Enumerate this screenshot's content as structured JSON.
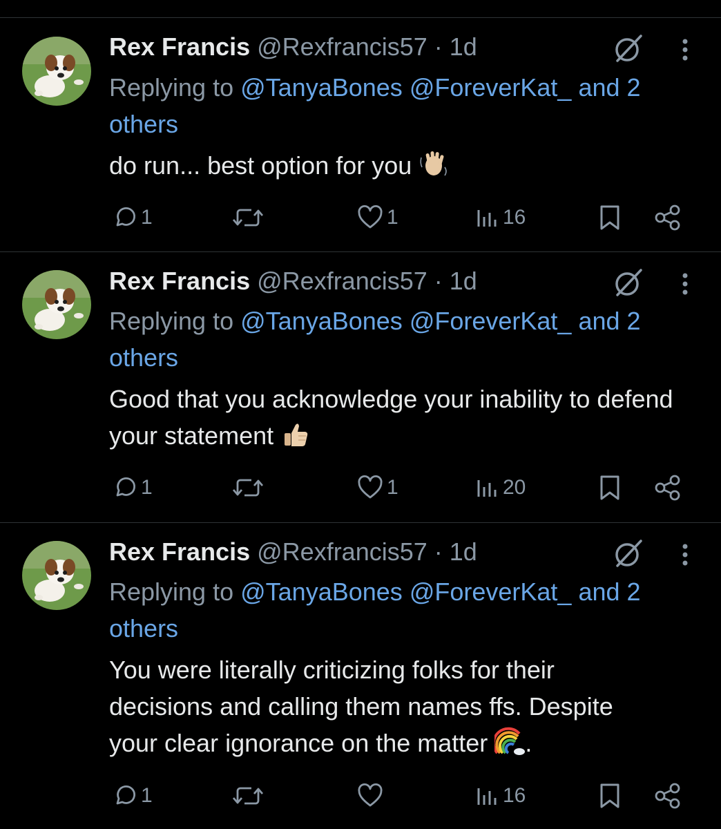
{
  "tweets": [
    {
      "name": "Rex Francis",
      "handle": "@Rexfrancis57",
      "dot": " · ",
      "time": "1d",
      "replying_prefix": "Replying to ",
      "mention1": "@TanyaBones",
      "mention2": "@ForeverKat_",
      "and_others": "and 2 others",
      "text": "do run... best option for you",
      "emoji": "waving-hand",
      "replies": "1",
      "retweets": "",
      "likes": "1",
      "views": "16"
    },
    {
      "name": "Rex Francis",
      "handle": "@Rexfrancis57",
      "dot": " · ",
      "time": "1d",
      "replying_prefix": "Replying to ",
      "mention1": "@TanyaBones",
      "mention2": "@ForeverKat_",
      "and_others": "and 2 others",
      "text": "Good that you acknowledge your inability to defend your statement",
      "emoji": "thumbs-up",
      "replies": "1",
      "retweets": "",
      "likes": "1",
      "views": "20"
    },
    {
      "name": "Rex Francis",
      "handle": "@Rexfrancis57",
      "dot": " · ",
      "time": "1d",
      "replying_prefix": "Replying to ",
      "mention1": "@TanyaBones",
      "mention2": "@ForeverKat_",
      "and_others": "and 2 others",
      "text_line1": "You were literally criticizing folks for their",
      "text_line2": "decisions and calling them names ffs. Despite",
      "text_line3": "your clear ignorance on the matter",
      "text_tail": ".",
      "emoji": "rainbow",
      "replies": "1",
      "retweets": "",
      "likes": "",
      "views": "16"
    }
  ],
  "colors": {
    "background": "#000000",
    "text_primary": "#e7e9ea",
    "text_secondary": "#8b98a5",
    "mention": "#6aa6e6",
    "divider": "#2f3336"
  },
  "icons": {
    "grok": "grok-icon",
    "more": "more-vertical-icon",
    "reply": "reply-icon",
    "retweet": "retweet-icon",
    "like": "heart-icon",
    "views": "views-icon",
    "bookmark": "bookmark-icon",
    "share": "share-icon"
  }
}
